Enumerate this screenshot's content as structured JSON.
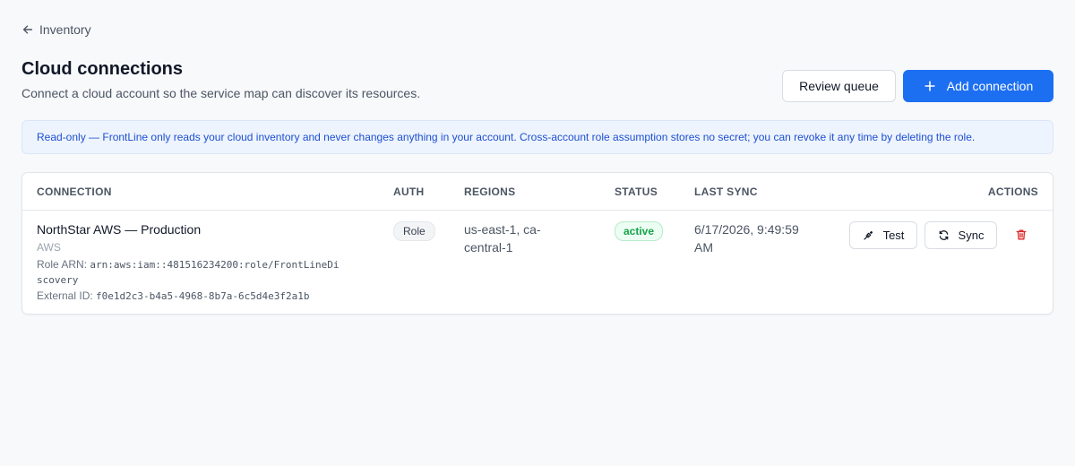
{
  "nav": {
    "back_label": "Inventory"
  },
  "header": {
    "title": "Cloud connections",
    "subtitle": "Connect a cloud account so the service map can discover its resources.",
    "review_queue_label": "Review queue",
    "add_connection_label": "Add connection"
  },
  "banner": {
    "text": "Read-only — FrontLine only reads your cloud inventory and never changes anything in your account. Cross-account role assumption stores no secret; you can revoke it any time by deleting the role."
  },
  "table": {
    "columns": {
      "connection": "Connection",
      "auth": "Auth",
      "regions": "Regions",
      "status": "Status",
      "last_sync": "Last sync",
      "actions": "Actions"
    },
    "rows": [
      {
        "name": "NorthStar AWS — Production",
        "provider": "AWS",
        "role_arn_label": "Role ARN:",
        "role_arn_line1": "arn:aws:iam::481516234200:role/FrontLineDi",
        "role_arn_line2": "scovery",
        "external_id_label": "External ID:",
        "external_id": "f0e1d2c3-b4a5-4968-8b7a-6c5d4e3f2a1b",
        "auth": "Role",
        "regions_line1": "us-east-1, ca-",
        "regions_line2": "central-1",
        "status": "active",
        "last_sync_line1": "6/17/2026, 9:49:59",
        "last_sync_line2": "AM",
        "test_label": "Test",
        "sync_label": "Sync"
      }
    ]
  },
  "icons": {
    "back": "arrow-left-icon",
    "add": "plus-icon",
    "test": "plug-icon",
    "sync": "refresh-icon",
    "delete": "trash-icon"
  },
  "colors": {
    "primary": "#1d6ff2",
    "banner_bg": "#eef4fe",
    "banner_text": "#1d4fd1",
    "status_active": "#16a34a",
    "danger": "#dc2626"
  }
}
